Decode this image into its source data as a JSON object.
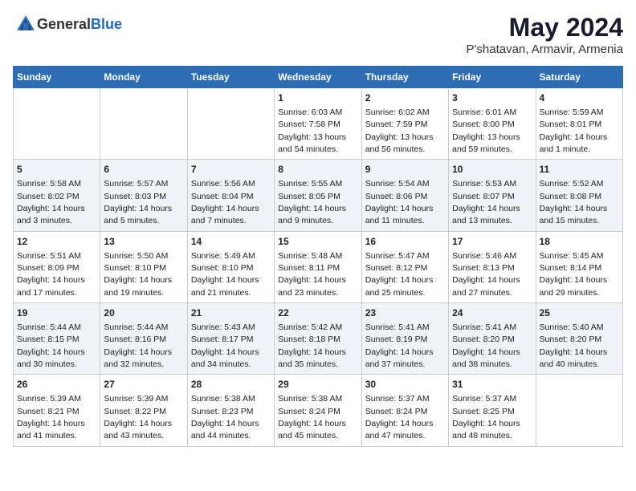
{
  "logo": {
    "general": "General",
    "blue": "Blue"
  },
  "title": "May 2024",
  "subtitle": "P'shatavan, Armavir, Armenia",
  "headers": [
    "Sunday",
    "Monday",
    "Tuesday",
    "Wednesday",
    "Thursday",
    "Friday",
    "Saturday"
  ],
  "weeks": [
    [
      {
        "day": "",
        "info": ""
      },
      {
        "day": "",
        "info": ""
      },
      {
        "day": "",
        "info": ""
      },
      {
        "day": "1",
        "info": "Sunrise: 6:03 AM\nSunset: 7:58 PM\nDaylight: 13 hours\nand 54 minutes."
      },
      {
        "day": "2",
        "info": "Sunrise: 6:02 AM\nSunset: 7:59 PM\nDaylight: 13 hours\nand 56 minutes."
      },
      {
        "day": "3",
        "info": "Sunrise: 6:01 AM\nSunset: 8:00 PM\nDaylight: 13 hours\nand 59 minutes."
      },
      {
        "day": "4",
        "info": "Sunrise: 5:59 AM\nSunset: 8:01 PM\nDaylight: 14 hours\nand 1 minute."
      }
    ],
    [
      {
        "day": "5",
        "info": "Sunrise: 5:58 AM\nSunset: 8:02 PM\nDaylight: 14 hours\nand 3 minutes."
      },
      {
        "day": "6",
        "info": "Sunrise: 5:57 AM\nSunset: 8:03 PM\nDaylight: 14 hours\nand 5 minutes."
      },
      {
        "day": "7",
        "info": "Sunrise: 5:56 AM\nSunset: 8:04 PM\nDaylight: 14 hours\nand 7 minutes."
      },
      {
        "day": "8",
        "info": "Sunrise: 5:55 AM\nSunset: 8:05 PM\nDaylight: 14 hours\nand 9 minutes."
      },
      {
        "day": "9",
        "info": "Sunrise: 5:54 AM\nSunset: 8:06 PM\nDaylight: 14 hours\nand 11 minutes."
      },
      {
        "day": "10",
        "info": "Sunrise: 5:53 AM\nSunset: 8:07 PM\nDaylight: 14 hours\nand 13 minutes."
      },
      {
        "day": "11",
        "info": "Sunrise: 5:52 AM\nSunset: 8:08 PM\nDaylight: 14 hours\nand 15 minutes."
      }
    ],
    [
      {
        "day": "12",
        "info": "Sunrise: 5:51 AM\nSunset: 8:09 PM\nDaylight: 14 hours\nand 17 minutes."
      },
      {
        "day": "13",
        "info": "Sunrise: 5:50 AM\nSunset: 8:10 PM\nDaylight: 14 hours\nand 19 minutes."
      },
      {
        "day": "14",
        "info": "Sunrise: 5:49 AM\nSunset: 8:10 PM\nDaylight: 14 hours\nand 21 minutes."
      },
      {
        "day": "15",
        "info": "Sunrise: 5:48 AM\nSunset: 8:11 PM\nDaylight: 14 hours\nand 23 minutes."
      },
      {
        "day": "16",
        "info": "Sunrise: 5:47 AM\nSunset: 8:12 PM\nDaylight: 14 hours\nand 25 minutes."
      },
      {
        "day": "17",
        "info": "Sunrise: 5:46 AM\nSunset: 8:13 PM\nDaylight: 14 hours\nand 27 minutes."
      },
      {
        "day": "18",
        "info": "Sunrise: 5:45 AM\nSunset: 8:14 PM\nDaylight: 14 hours\nand 29 minutes."
      }
    ],
    [
      {
        "day": "19",
        "info": "Sunrise: 5:44 AM\nSunset: 8:15 PM\nDaylight: 14 hours\nand 30 minutes."
      },
      {
        "day": "20",
        "info": "Sunrise: 5:44 AM\nSunset: 8:16 PM\nDaylight: 14 hours\nand 32 minutes."
      },
      {
        "day": "21",
        "info": "Sunrise: 5:43 AM\nSunset: 8:17 PM\nDaylight: 14 hours\nand 34 minutes."
      },
      {
        "day": "22",
        "info": "Sunrise: 5:42 AM\nSunset: 8:18 PM\nDaylight: 14 hours\nand 35 minutes."
      },
      {
        "day": "23",
        "info": "Sunrise: 5:41 AM\nSunset: 8:19 PM\nDaylight: 14 hours\nand 37 minutes."
      },
      {
        "day": "24",
        "info": "Sunrise: 5:41 AM\nSunset: 8:20 PM\nDaylight: 14 hours\nand 38 minutes."
      },
      {
        "day": "25",
        "info": "Sunrise: 5:40 AM\nSunset: 8:20 PM\nDaylight: 14 hours\nand 40 minutes."
      }
    ],
    [
      {
        "day": "26",
        "info": "Sunrise: 5:39 AM\nSunset: 8:21 PM\nDaylight: 14 hours\nand 41 minutes."
      },
      {
        "day": "27",
        "info": "Sunrise: 5:39 AM\nSunset: 8:22 PM\nDaylight: 14 hours\nand 43 minutes."
      },
      {
        "day": "28",
        "info": "Sunrise: 5:38 AM\nSunset: 8:23 PM\nDaylight: 14 hours\nand 44 minutes."
      },
      {
        "day": "29",
        "info": "Sunrise: 5:38 AM\nSunset: 8:24 PM\nDaylight: 14 hours\nand 45 minutes."
      },
      {
        "day": "30",
        "info": "Sunrise: 5:37 AM\nSunset: 8:24 PM\nDaylight: 14 hours\nand 47 minutes."
      },
      {
        "day": "31",
        "info": "Sunrise: 5:37 AM\nSunset: 8:25 PM\nDaylight: 14 hours\nand 48 minutes."
      },
      {
        "day": "",
        "info": ""
      }
    ]
  ]
}
